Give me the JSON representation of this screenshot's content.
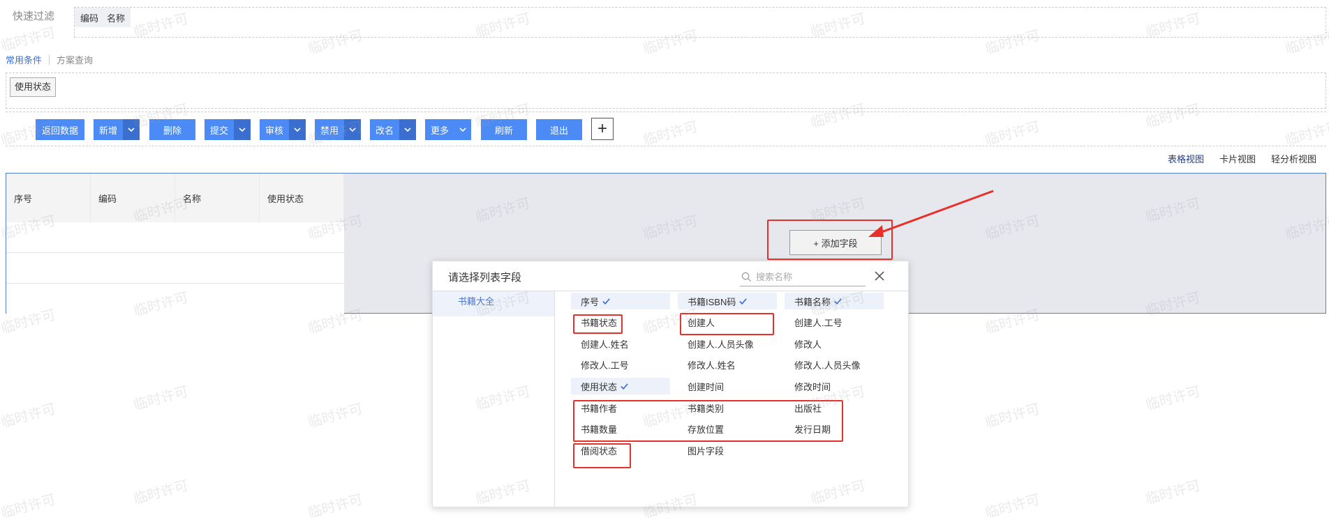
{
  "filter": {
    "quick_label": "快速过滤",
    "quick_fields": [
      "编码",
      "名称"
    ],
    "cond_tabs": [
      "常用条件",
      "方案查询"
    ],
    "chip_use_state": "使用状态"
  },
  "toolbar": {
    "return_data": "返回数据",
    "add": "新增",
    "delete": "删除",
    "submit": "提交",
    "audit": "审核",
    "disable": "禁用",
    "rename": "改名",
    "more": "更多",
    "refresh": "刷新",
    "exit": "退出",
    "plus": "+"
  },
  "views": {
    "table": "表格视图",
    "card": "卡片视图",
    "analysis": "轻分析视图"
  },
  "grid": {
    "columns": [
      "序号",
      "编码",
      "名称",
      "使用状态"
    ]
  },
  "add_field_button": "+ 添加字段",
  "dialog": {
    "title": "请选择列表字段",
    "search_placeholder": "搜索名称",
    "category": "书籍大全",
    "fields": [
      {
        "label": "序号",
        "checked": true
      },
      {
        "label": "书籍ISBN码",
        "checked": true
      },
      {
        "label": "书籍名称",
        "checked": true
      },
      {
        "label": "书籍状态",
        "checked": false
      },
      {
        "label": "创建人",
        "checked": false
      },
      {
        "label": "创建人.工号",
        "checked": false
      },
      {
        "label": "创建人.姓名",
        "checked": false
      },
      {
        "label": "创建人.人员头像",
        "checked": false
      },
      {
        "label": "修改人",
        "checked": false
      },
      {
        "label": "修改人.工号",
        "checked": false
      },
      {
        "label": "修改人.姓名",
        "checked": false
      },
      {
        "label": "修改人.人员头像",
        "checked": false
      },
      {
        "label": "使用状态",
        "checked": true
      },
      {
        "label": "创建时间",
        "checked": false
      },
      {
        "label": "修改时间",
        "checked": false
      },
      {
        "label": "书籍作者",
        "checked": false
      },
      {
        "label": "书籍类别",
        "checked": false
      },
      {
        "label": "出版社",
        "checked": false
      },
      {
        "label": "书籍数量",
        "checked": false
      },
      {
        "label": "存放位置",
        "checked": false
      },
      {
        "label": "发行日期",
        "checked": false
      },
      {
        "label": "借阅状态",
        "checked": false
      },
      {
        "label": "图片字段",
        "checked": false
      }
    ]
  },
  "watermark": "临时许可",
  "colors": {
    "primary_button": "#4c8bf5",
    "annotation_red": "#e8302a",
    "grid_border": "#4f7fd6",
    "active_link": "#3b6fd8"
  }
}
